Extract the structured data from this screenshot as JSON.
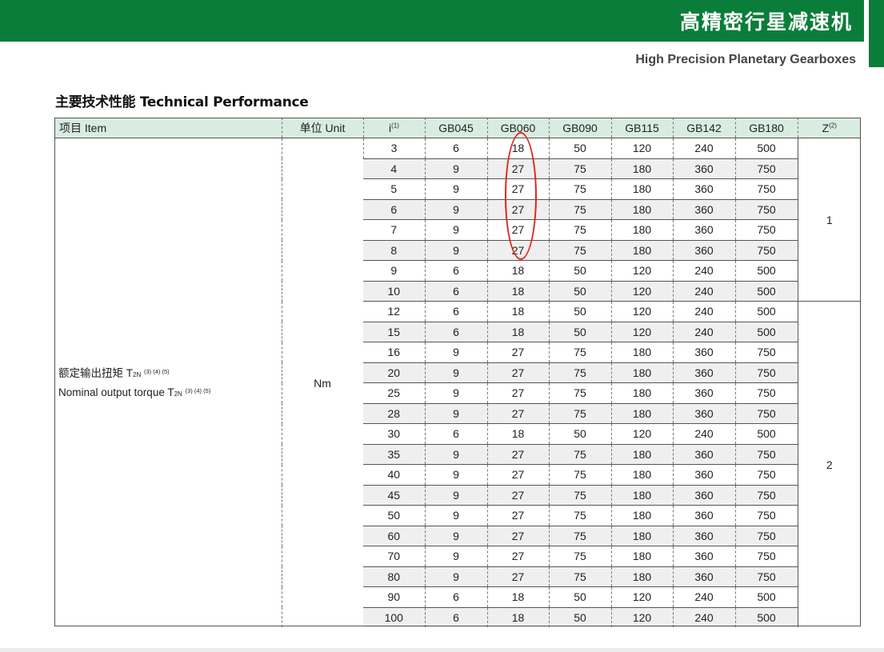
{
  "header": {
    "banner_title": "高精密行星减速机",
    "subtitle": "High Precision Planetary Gearboxes",
    "brand_color": "#0b7d3a"
  },
  "section": {
    "title": "主要技术性能 Technical Performance"
  },
  "table": {
    "columns": {
      "item": "项目 Item",
      "unit": "单位 Unit",
      "ratio": "i",
      "ratio_note": "(1)",
      "gb045": "GB045",
      "gb060": "GB060",
      "gb090": "GB090",
      "gb115": "GB115",
      "gb142": "GB142",
      "gb180": "GB180",
      "stages": "Z",
      "stages_note": "(2)"
    },
    "item": {
      "zh": "额定输出扭矩 T",
      "en": "Nominal output torque T",
      "subscript": "2N",
      "notes": "(3) (4) (5)"
    },
    "unit": "Nm",
    "z_values": [
      "1",
      "2"
    ],
    "rows": [
      [
        "3",
        "6",
        "18",
        "50",
        "120",
        "240",
        "500"
      ],
      [
        "4",
        "9",
        "27",
        "75",
        "180",
        "360",
        "750"
      ],
      [
        "5",
        "9",
        "27",
        "75",
        "180",
        "360",
        "750"
      ],
      [
        "6",
        "9",
        "27",
        "75",
        "180",
        "360",
        "750"
      ],
      [
        "7",
        "9",
        "27",
        "75",
        "180",
        "360",
        "750"
      ],
      [
        "8",
        "9",
        "27",
        "75",
        "180",
        "360",
        "750"
      ],
      [
        "9",
        "6",
        "18",
        "50",
        "120",
        "240",
        "500"
      ],
      [
        "10",
        "6",
        "18",
        "50",
        "120",
        "240",
        "500"
      ],
      [
        "12",
        "6",
        "18",
        "50",
        "120",
        "240",
        "500"
      ],
      [
        "15",
        "6",
        "18",
        "50",
        "120",
        "240",
        "500"
      ],
      [
        "16",
        "9",
        "27",
        "75",
        "180",
        "360",
        "750"
      ],
      [
        "20",
        "9",
        "27",
        "75",
        "180",
        "360",
        "750"
      ],
      [
        "25",
        "9",
        "27",
        "75",
        "180",
        "360",
        "750"
      ],
      [
        "28",
        "9",
        "27",
        "75",
        "180",
        "360",
        "750"
      ],
      [
        "30",
        "6",
        "18",
        "50",
        "120",
        "240",
        "500"
      ],
      [
        "35",
        "9",
        "27",
        "75",
        "180",
        "360",
        "750"
      ],
      [
        "40",
        "9",
        "27",
        "75",
        "180",
        "360",
        "750"
      ],
      [
        "45",
        "9",
        "27",
        "75",
        "180",
        "360",
        "750"
      ],
      [
        "50",
        "9",
        "27",
        "75",
        "180",
        "360",
        "750"
      ],
      [
        "60",
        "9",
        "27",
        "75",
        "180",
        "360",
        "750"
      ],
      [
        "70",
        "9",
        "27",
        "75",
        "180",
        "360",
        "750"
      ],
      [
        "80",
        "9",
        "27",
        "75",
        "180",
        "360",
        "750"
      ],
      [
        "90",
        "6",
        "18",
        "50",
        "120",
        "240",
        "500"
      ],
      [
        "100",
        "6",
        "18",
        "50",
        "120",
        "240",
        "500"
      ]
    ]
  },
  "annotation": {
    "color": "#e0261b",
    "marked_column": "GB060",
    "marked_ratios": [
      "3",
      "4",
      "5",
      "6",
      "7",
      "8"
    ]
  }
}
